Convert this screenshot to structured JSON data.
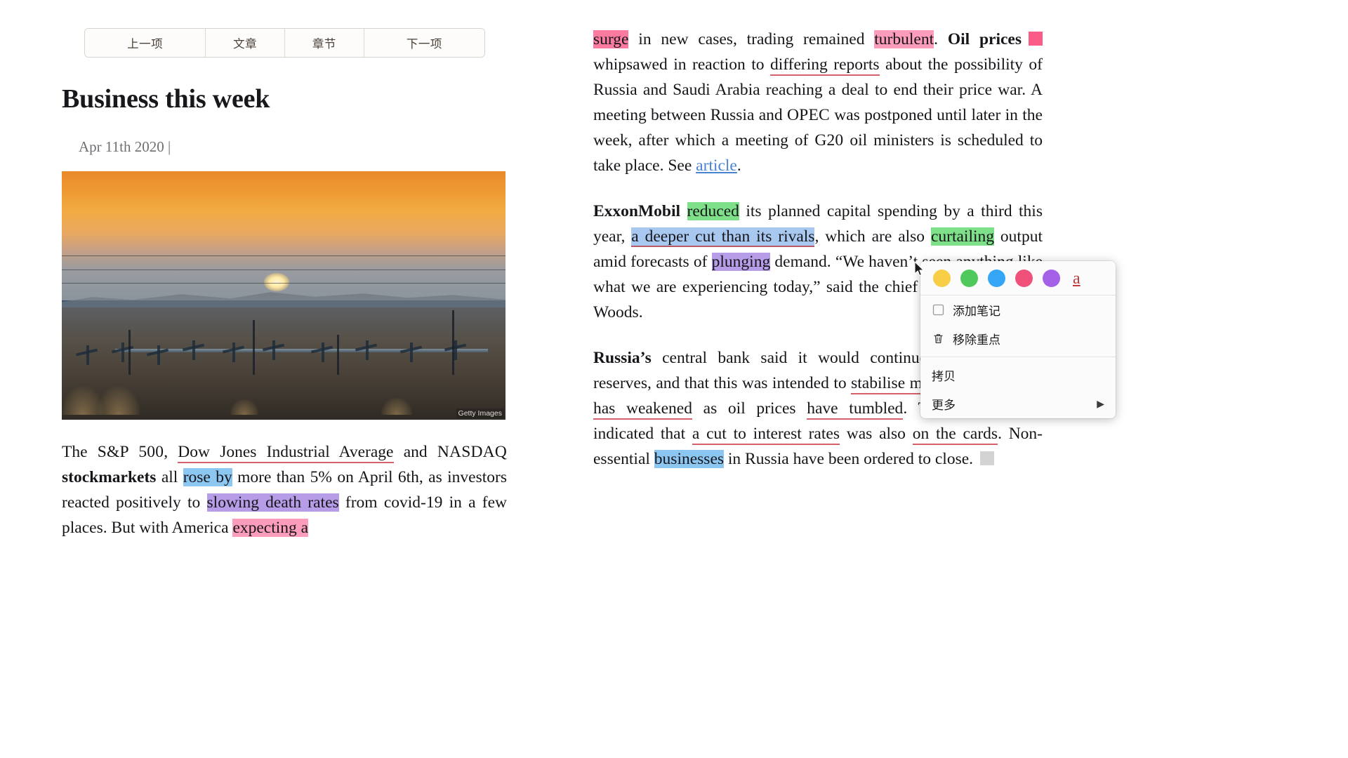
{
  "nav": {
    "items": [
      {
        "label": "上一项",
        "name": "prev"
      },
      {
        "label": "文章",
        "name": "article"
      },
      {
        "label": "章节",
        "name": "chapter"
      },
      {
        "label": "下一项",
        "name": "next"
      }
    ]
  },
  "article": {
    "title": "Business this week",
    "date": "Apr 11th 2020 |",
    "image_credit": "Getty Images"
  },
  "left_paragraph": {
    "t1": "The ",
    "sc1": "S&P 500",
    "t2": ", ",
    "ul1": "Dow Jones Industrial Average",
    "t3": " and ",
    "sc2": "NASDAQ",
    "t4": " ",
    "b1": "stockmarkets",
    "t5": " all ",
    "hl1": "rose by",
    "t6": " more than 5% on April 6th, as investors reacted positively to ",
    "hl2": "slowing death rates",
    "t7": " from covid-19 in a few places. But with America ",
    "hl3": "expecting a"
  },
  "right_paragraphs": {
    "p1": {
      "hl1": "surge",
      "t1": " in new cases, trading remained ",
      "hl2": "turbulent",
      "t2": ". ",
      "b1": "Oil prices",
      "t3": " whipsawed in reaction to ",
      "ul1": "differing reports",
      "t4": " about the possibility of Russia and Saudi Arabia reaching a deal to end their price war. A meeting between Russia and ",
      "sc1": "OPEC",
      "t5": " was postponed until later in the week, after which a meeting of ",
      "sc2": "G20",
      "t6": " oil ministers is scheduled to take place. See ",
      "link1": "article",
      "t7": "."
    },
    "p2": {
      "b1": "ExxonMobil",
      "t1": " ",
      "hl1": "reduced",
      "t2": " its planned capital spending by a third this year, ",
      "sel1": "a deeper cut than its rivals",
      "t3": ", which are also ",
      "hl2": "curtailing",
      "t4": " output amid forecasts of ",
      "hl3": "plunging",
      "t5": " demand. “We haven’t seen anything like what we are experiencing today,” said the chief executive, Darren Woods."
    },
    "p3": {
      "b1": "Russia’s",
      "t1": " central bank said it would continue to sell foreign reserves, and that this was intended to ",
      "ul1": "stabilise markets",
      "t2": ". ",
      "ul2": "The rouble has weakened",
      "t3": " as oil prices ",
      "ul3": "have tumbled",
      "t4": ". The central bank indicated that ",
      "ul4": "a cut to interest rates",
      "t5": " was also ",
      "ul5": "on the cards",
      "t6": ". Non-essential ",
      "hl1": "businesses",
      "t7": " in Russia have been ordered to close."
    }
  },
  "popup": {
    "swatches": [
      {
        "name": "yellow",
        "color": "#f7ce46"
      },
      {
        "name": "green",
        "color": "#4fc95b"
      },
      {
        "name": "blue",
        "color": "#34a6f5"
      },
      {
        "name": "pink",
        "color": "#f0517a"
      },
      {
        "name": "purple",
        "color": "#a461e8"
      }
    ],
    "underline_label": "a",
    "items": [
      {
        "label": "添加笔记",
        "icon": "note-icon",
        "name": "add-note"
      },
      {
        "label": "移除重点",
        "icon": "trash-icon",
        "name": "remove-highlight"
      },
      {
        "label": "拷贝",
        "icon": "",
        "name": "copy"
      },
      {
        "label": "更多",
        "icon": "",
        "name": "more",
        "arrow": "▶"
      }
    ]
  },
  "colors": {
    "highlight_pink": "#fb7ba0",
    "highlight_blue": "#8cc7f2",
    "highlight_green": "#7fe08a",
    "highlight_purple": "#b79de8",
    "underline_red": "#d4606b",
    "link_blue": "#4a83d4",
    "marker_pink": "#fb5b87",
    "marker_gray": "#d3d3d3"
  }
}
